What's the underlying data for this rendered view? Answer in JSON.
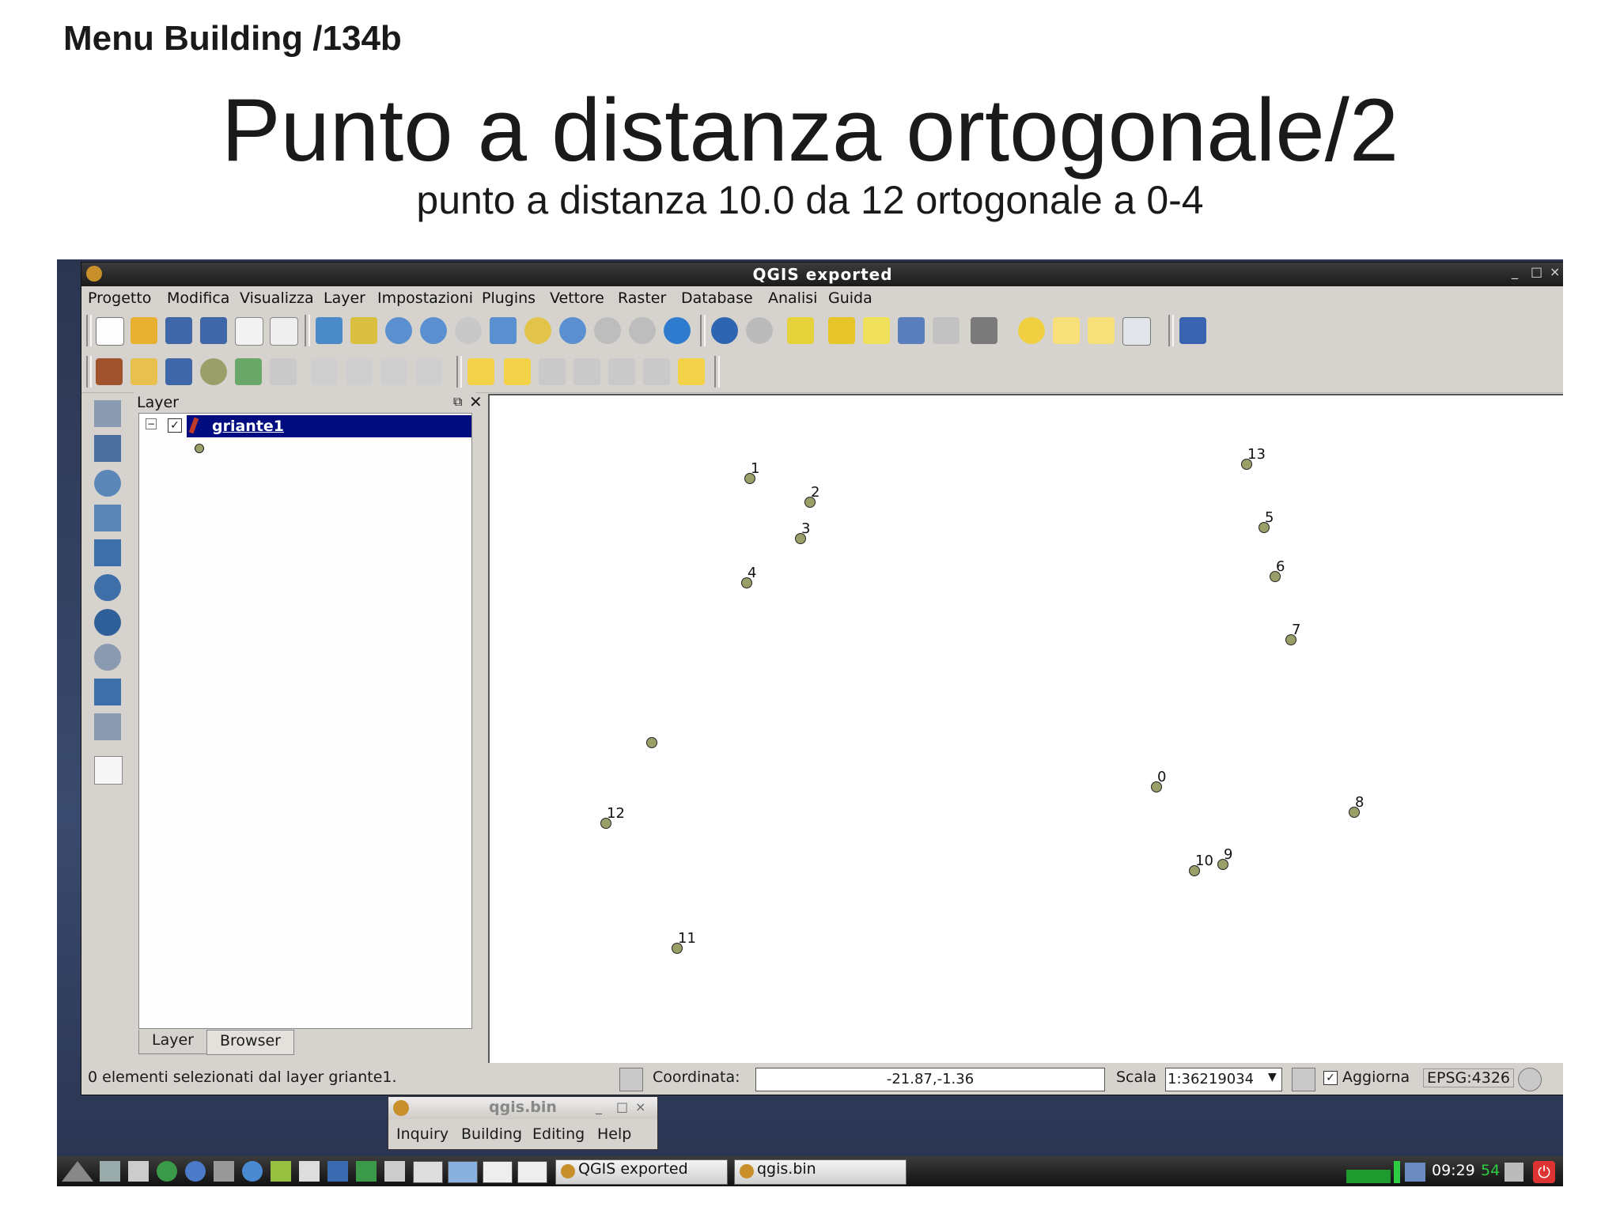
{
  "slide": {
    "header": "Menu Building /134b",
    "title": "Punto a distanza ortogonale/2",
    "subtitle": "punto a distanza 10.0 da 12 ortogonale a 0-4"
  },
  "window": {
    "title": "QGIS exported",
    "controls": [
      "_",
      "□",
      "×"
    ]
  },
  "menu": [
    "Progetto",
    "Modifica",
    "Visualizza",
    "Layer",
    "Impostazioni",
    "Plugins",
    "Vettore",
    "Raster",
    "Database",
    "Analisi",
    "Guida"
  ],
  "layer_panel": {
    "title": "Layer",
    "layer_name": "griante1",
    "tabs": [
      "Layer",
      "Browser"
    ]
  },
  "map": {
    "points": [
      {
        "label": "0"
      },
      {
        "label": "1"
      },
      {
        "label": "2"
      },
      {
        "label": "3"
      },
      {
        "label": "4"
      },
      {
        "label": "5"
      },
      {
        "label": "6"
      },
      {
        "label": "7"
      },
      {
        "label": "8"
      },
      {
        "label": "9"
      },
      {
        "label": "10"
      },
      {
        "label": "11"
      },
      {
        "label": "12"
      },
      {
        "label": "13"
      },
      {
        "label": ""
      }
    ]
  },
  "status": {
    "message": "0 elementi selezionati dal layer griante1.",
    "coord_label": "Coordinata:",
    "coord_value": "-21.87,-1.36",
    "scale_label": "Scala",
    "scale_value": "1:36219034",
    "render_label": "Aggiorna",
    "crs": "EPSG:4326"
  },
  "qgisbin": {
    "title": "qgis.bin",
    "menu": [
      "Inquiry",
      "Building",
      "Editing",
      "Help"
    ]
  },
  "taskbar": {
    "tasks": [
      "QGIS exported",
      "qgis.bin"
    ],
    "time": "09:29",
    "time_seconds": "54"
  }
}
